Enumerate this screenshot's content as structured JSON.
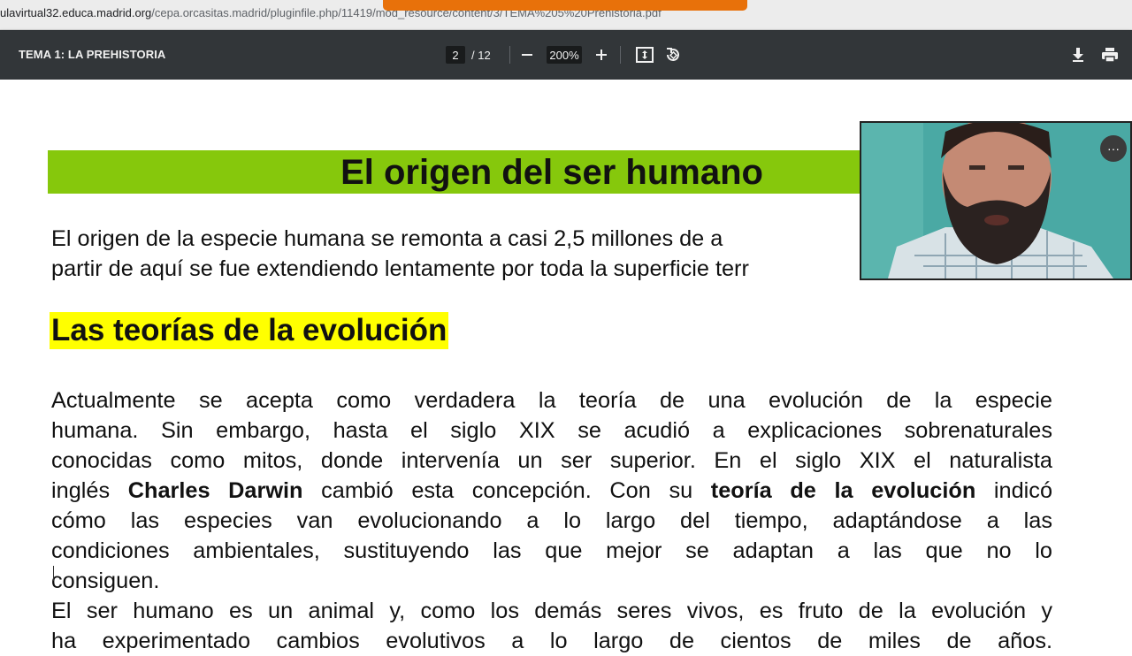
{
  "browser": {
    "url_host": "ulavirtual32.educa.madrid.org",
    "url_path": "/cepa.orcasitas.madrid/pluginfile.php/11419/mod_resource/content/3/TEMA%205%20Prehistoria.pdf"
  },
  "viewer": {
    "title": "TEMA 1: LA PREHISTORIA",
    "current_page": "2",
    "total_pages": "/ 12",
    "zoom": "200%"
  },
  "icons": {
    "zoom_out": "minus-icon",
    "zoom_in": "plus-icon",
    "fit": "fit-page-icon",
    "rotate": "rotate-icon",
    "download": "download-icon",
    "print": "print-icon",
    "cam_menu": "more-options-icon"
  },
  "colors": {
    "toolbar_bg": "#323639",
    "title_band": "#86c80c",
    "heading_highlight": "#ffff00",
    "share_banner": "#e8710a"
  },
  "document": {
    "title": "El origen del ser humano",
    "intro_lines": [
      "El origen de la especie humana se remonta a casi 2,5 millones de a",
      "partir de aquí se fue extendiendo lentamente por toda la superficie terr"
    ],
    "section_heading": "Las teorías de la evolución",
    "paragraph1": {
      "l1": "Actualmente se acepta como verdadera la teoría de una evolución de la especie",
      "l2": "humana. Sin embargo, hasta el siglo XIX se acudió a explicaciones sobrenaturales",
      "l3": "conocidas como mitos, donde intervenía un ser superior. En el siglo XIX el naturalista",
      "l4_a": "inglés ",
      "l4_b": "Charles Darwin",
      "l4_c": " cambió esta concepción. Con su ",
      "l4_d": "teoría de la evolución",
      "l4_e": " indicó",
      "l5": "cómo las especies van evolucionando a lo largo del tiempo, adaptándose a las",
      "l6": "condiciones ambientales, sustituyendo las que mejor se adaptan a las que no lo",
      "l7": "consiguen."
    },
    "paragraph2": {
      "l1": "El ser humano es un animal y, como los demás seres vivos, es fruto de la evolución y",
      "l2": "ha experimentado cambios evolutivos a lo largo de cientos de miles de años."
    }
  },
  "webcam": {
    "menu_glyph": "···"
  }
}
